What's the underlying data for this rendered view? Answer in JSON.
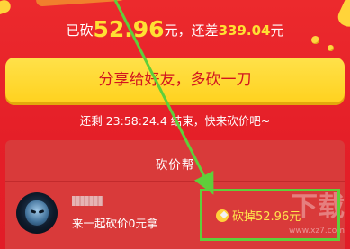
{
  "status": {
    "prefix": "已砍",
    "cut_amount": "52.96",
    "unit_1": "元，还差",
    "remaining_amount": "339.04",
    "unit_2": "元"
  },
  "share_button": {
    "label": "分享给好友，多砍一刀"
  },
  "timer": {
    "text": "还剩 23:58:24.4 结束，快来砍价吧~"
  },
  "helpers_panel": {
    "title": "砍价帮",
    "items": [
      {
        "action": "来一起砍价0元拿",
        "result": "砍掉52.96元"
      }
    ]
  },
  "watermark": {
    "text": "下载",
    "url": "www.xz7.com"
  },
  "colors": {
    "background": "#e8212a",
    "accent_yellow": "#ffd21f",
    "highlight_green": "#5fcf3a"
  }
}
